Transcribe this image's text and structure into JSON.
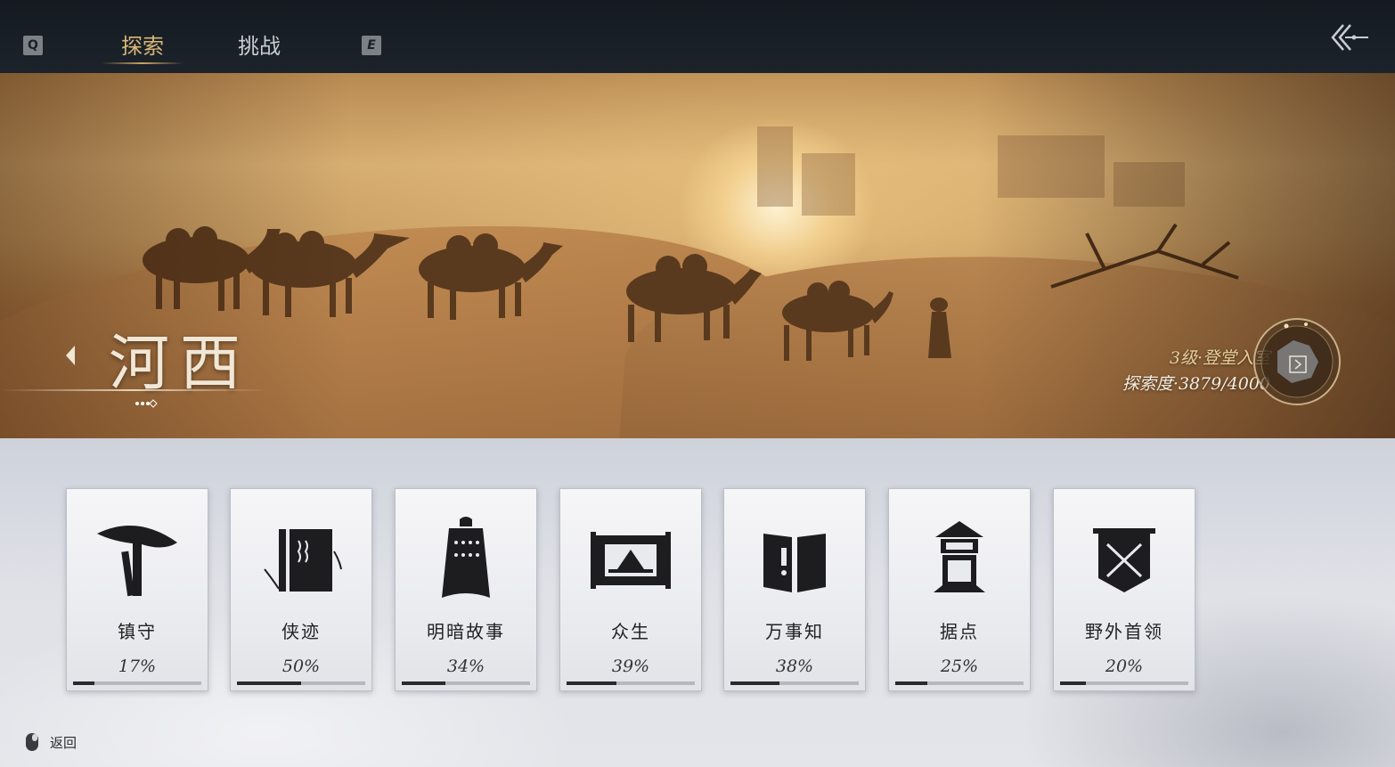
{
  "top_bar": {
    "q_key": "Q",
    "e_key": "E",
    "tabs": [
      {
        "label": "探索",
        "active": true
      },
      {
        "label": "挑战",
        "active": false
      }
    ],
    "back_icon": "double-chevron-back-icon"
  },
  "banner": {
    "region_name": "河西",
    "level": "3级·登堂入室",
    "progress": "探索度·3879/4000",
    "progress_value": 3879,
    "progress_max": 4000
  },
  "cards": [
    {
      "title": "镇守",
      "percent": "17%",
      "value": 17,
      "icon": "straw-hat-sword-icon"
    },
    {
      "title": "侠迹",
      "percent": "50%",
      "value": 50,
      "icon": "book-bamboo-icon"
    },
    {
      "title": "明暗故事",
      "percent": "34%",
      "value": 34,
      "icon": "bronze-bell-icon"
    },
    {
      "title": "众生",
      "percent": "39%",
      "value": 39,
      "icon": "scroll-painting-icon"
    },
    {
      "title": "万事知",
      "percent": "38%",
      "value": 38,
      "icon": "open-book-icon"
    },
    {
      "title": "据点",
      "percent": "25%",
      "value": 25,
      "icon": "watchtower-icon"
    },
    {
      "title": "野外首领",
      "percent": "20%",
      "value": 20,
      "icon": "crossed-swords-banner-icon"
    }
  ],
  "footer": {
    "back_label": "返回",
    "icon": "mouse-icon"
  },
  "colors": {
    "accent": "#d9b878",
    "topbar": "#1a2027",
    "card_bar": "#2a2a2e"
  }
}
